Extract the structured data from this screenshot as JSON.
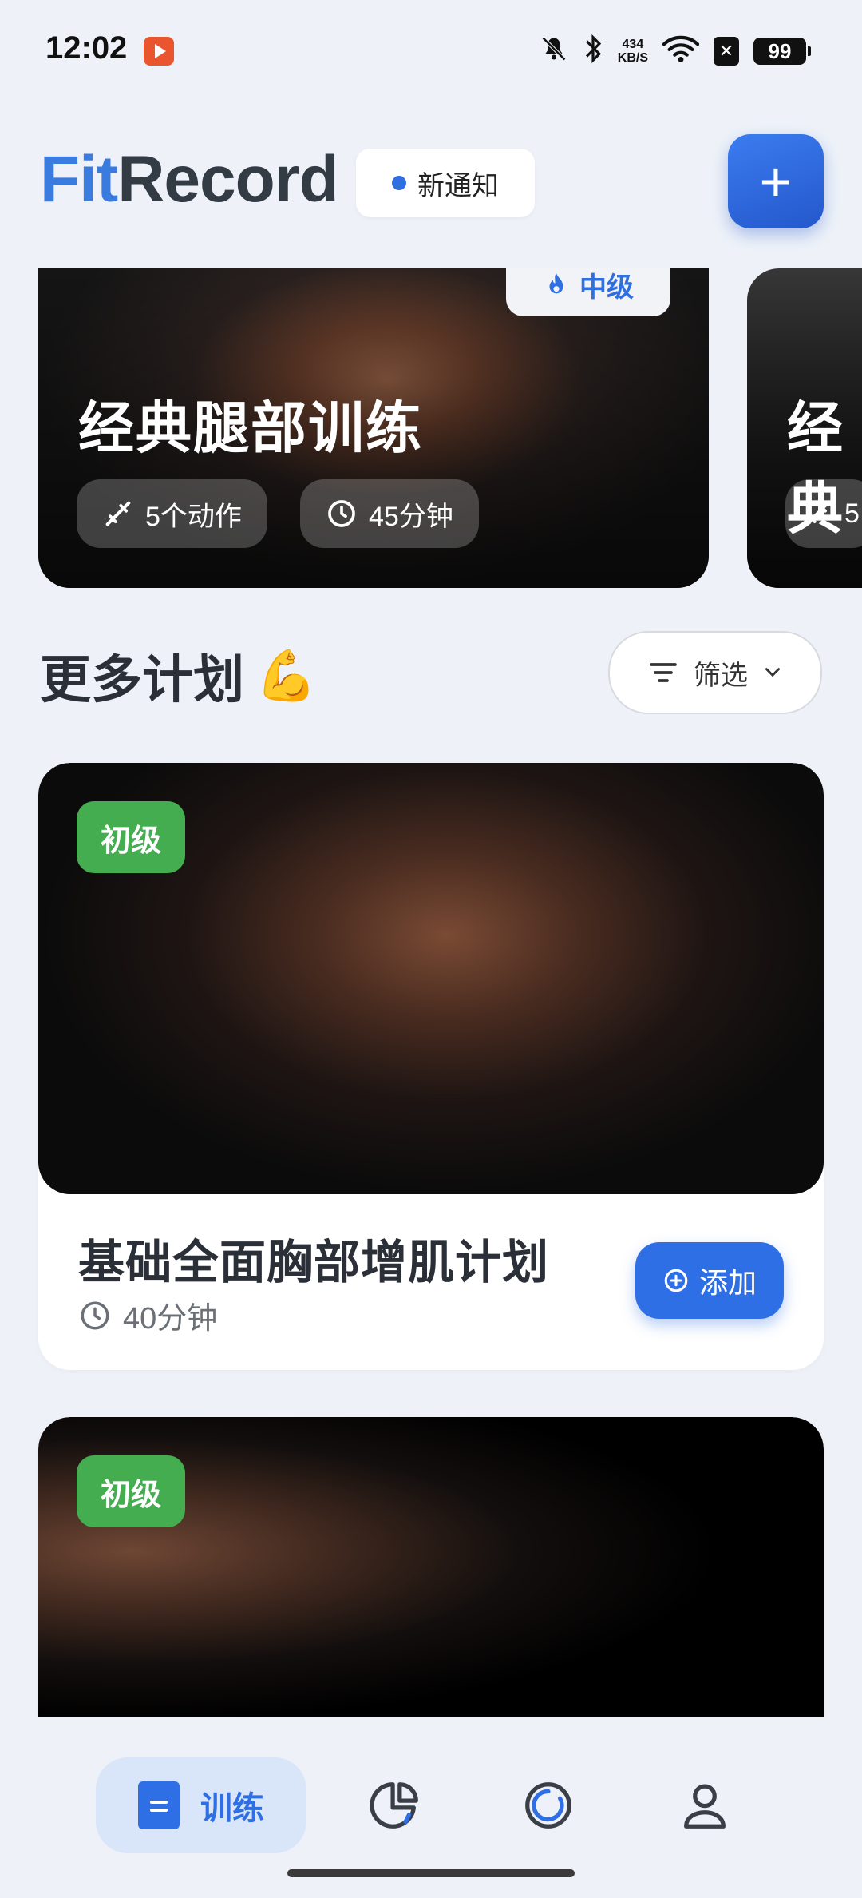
{
  "status_bar": {
    "time": "12:02",
    "speed_value": "434",
    "speed_unit": "KB/S",
    "battery": "99",
    "icons": [
      "app-notification-icon",
      "mute-bell-icon",
      "bluetooth-icon",
      "wifi-icon",
      "sim-x-icon",
      "battery-icon"
    ]
  },
  "header": {
    "title_accent": "Fit",
    "title_rest": "Record",
    "notification_label": "新通知",
    "add_button_label": "+"
  },
  "featured": [
    {
      "title": "经典腿部训练",
      "level": "中级",
      "exercises": "5个动作",
      "duration": "45分钟"
    },
    {
      "title": "经典",
      "exercises": "5"
    }
  ],
  "section": {
    "title": "更多计划",
    "emoji": "💪",
    "filter_label": "筛选"
  },
  "plans": [
    {
      "level": "初级",
      "title": "基础全面胸部增肌计划",
      "duration": "40分钟",
      "add_label": "添加"
    },
    {
      "level": "初级"
    }
  ],
  "bottom_nav": {
    "items": [
      {
        "label": "训练",
        "icon": "training-icon",
        "active": true
      },
      {
        "label": "",
        "icon": "stats-pie-icon",
        "active": false
      },
      {
        "label": "",
        "icon": "progress-ring-icon",
        "active": false
      },
      {
        "label": "",
        "icon": "profile-icon",
        "active": false
      }
    ]
  },
  "colors": {
    "accent": "#2f6fe6",
    "brand_blue": "#3a7be0",
    "beginner_green": "#43ad4f",
    "background": "#eef2f8"
  }
}
